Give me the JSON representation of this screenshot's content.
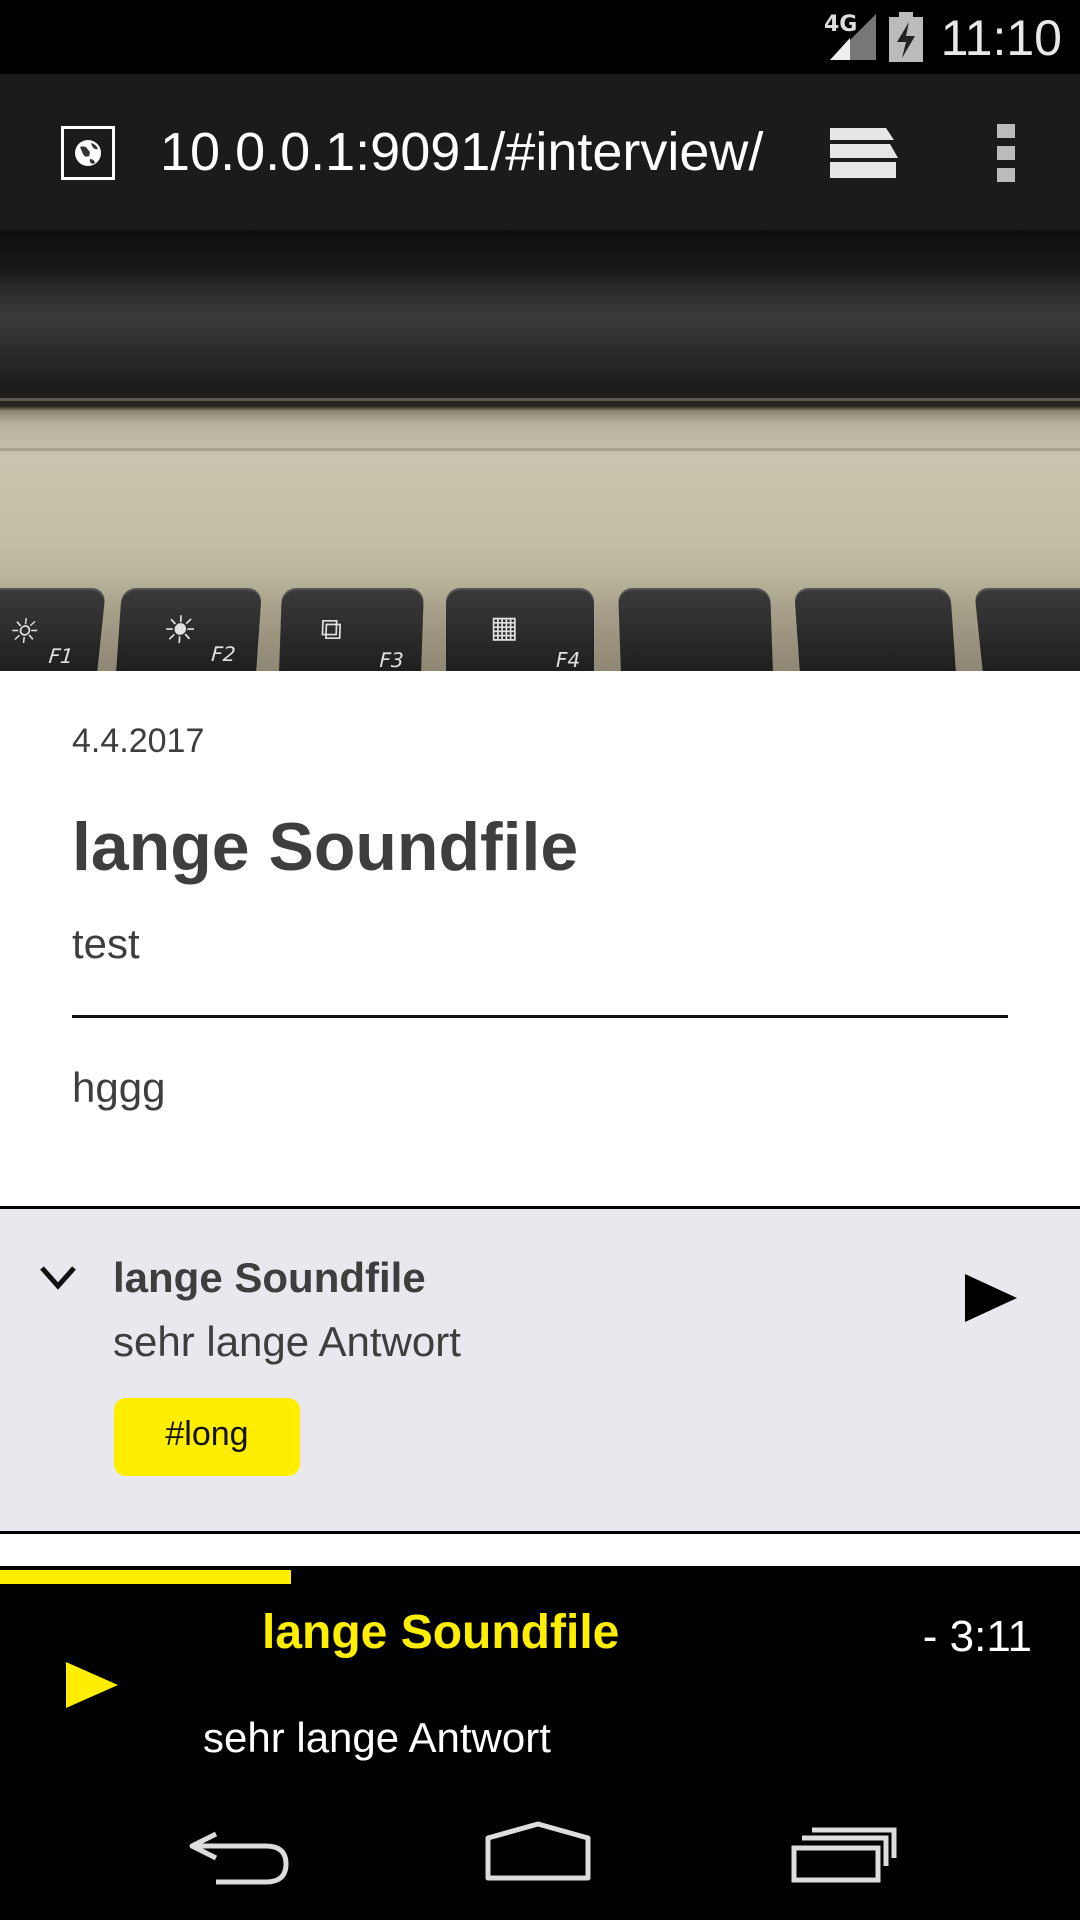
{
  "status_bar": {
    "network": "4G",
    "time": "11:10"
  },
  "browser": {
    "url": "10.0.0.1:9091/#interview/"
  },
  "article": {
    "date": "4.4.2017",
    "title": "lange Soundfile",
    "subtitle": "test",
    "body": "hggg"
  },
  "card": {
    "title": "lange Soundfile",
    "subtitle": "sehr lange Antwort",
    "tag": "#long"
  },
  "player": {
    "title": "lange Soundfile",
    "subtitle": "sehr lange Antwort",
    "time_remaining": "- 3:11",
    "progress": 0.333
  },
  "hero_keys": [
    "F1",
    "F2",
    "F3",
    "F4"
  ],
  "colors": {
    "accent": "#ffee00",
    "card_bg": "#e8e8ee",
    "toolbar": "#1b1b1b"
  },
  "icons": [
    "signal-icon",
    "battery-icon",
    "globe-icon",
    "tabs-icon",
    "overflow-menu-icon",
    "chevron-down-icon",
    "play-icon",
    "back-icon",
    "home-icon",
    "recent-apps-icon"
  ]
}
